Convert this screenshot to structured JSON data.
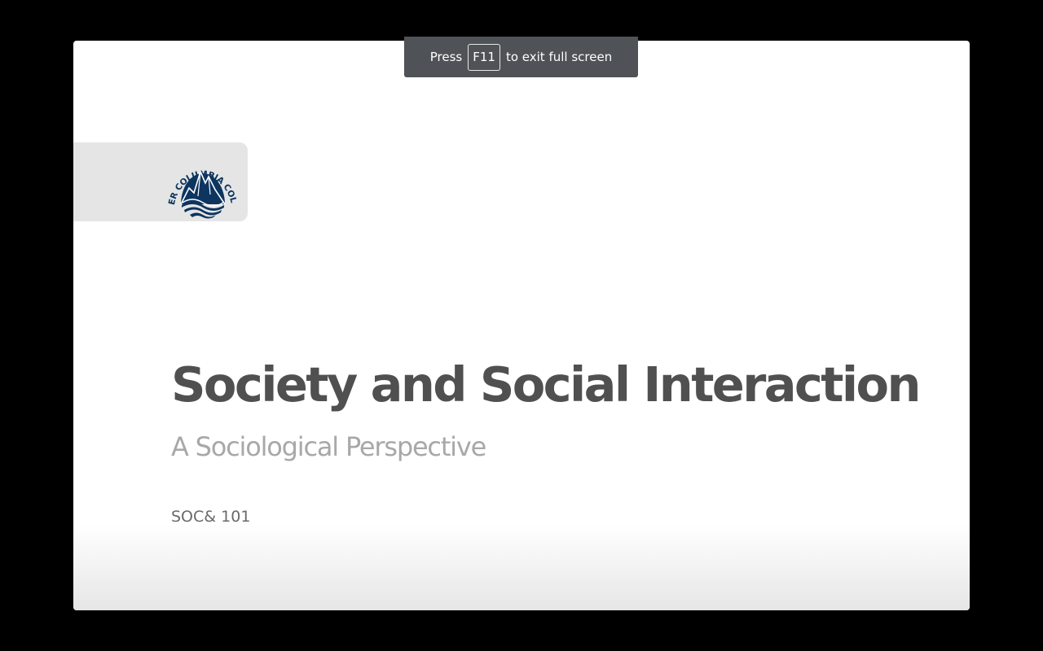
{
  "fullscreen_notice": {
    "before": "Press",
    "key": "F11",
    "after": "to exit full screen"
  },
  "slide": {
    "logo_text": "LOWER COLUMBIA COLLEGE",
    "title": "Society and Social Interaction",
    "subtitle": "A Sociological Perspective",
    "course": "SOC& 101"
  },
  "colors": {
    "background": "#000000",
    "slide_background": "#ffffff",
    "logo_tab": "#e5e5e5",
    "logo_navy": "#0d3560",
    "title": "#505050",
    "subtitle": "#a8a8a8",
    "course": "#6a6a6a",
    "notice_background": "#4f5256"
  }
}
